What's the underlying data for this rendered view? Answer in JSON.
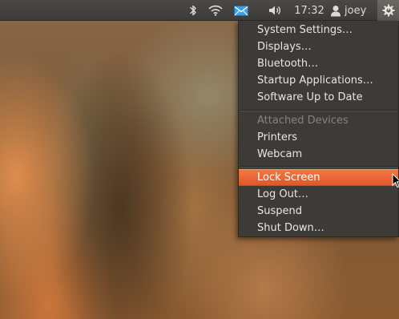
{
  "panel": {
    "clock": "17:32",
    "username": "joey",
    "indicators": {
      "bluetooth_icon": "bluetooth-icon",
      "network_icon": "wifi-icon",
      "messaging_icon": "envelope-icon",
      "sound_icon": "speaker-icon",
      "user_icon": "person-icon",
      "session_icon": "gear-power-icon"
    },
    "messaging_color": "#3ba0e6"
  },
  "menu": {
    "items": [
      {
        "label": "System Settings…"
      },
      {
        "label": "Displays…"
      },
      {
        "label": "Bluetooth…"
      },
      {
        "label": "Startup Applications…"
      },
      {
        "label": "Software Up to Date"
      },
      {
        "label": "Attached Devices",
        "disabled": true
      },
      {
        "label": "Printers"
      },
      {
        "label": "Webcam"
      },
      {
        "label": "Lock Screen",
        "highlighted": true
      },
      {
        "label": "Log Out…"
      },
      {
        "label": "Suspend"
      },
      {
        "label": "Shut Down…"
      }
    ],
    "highlight_color": "#e8642f"
  }
}
